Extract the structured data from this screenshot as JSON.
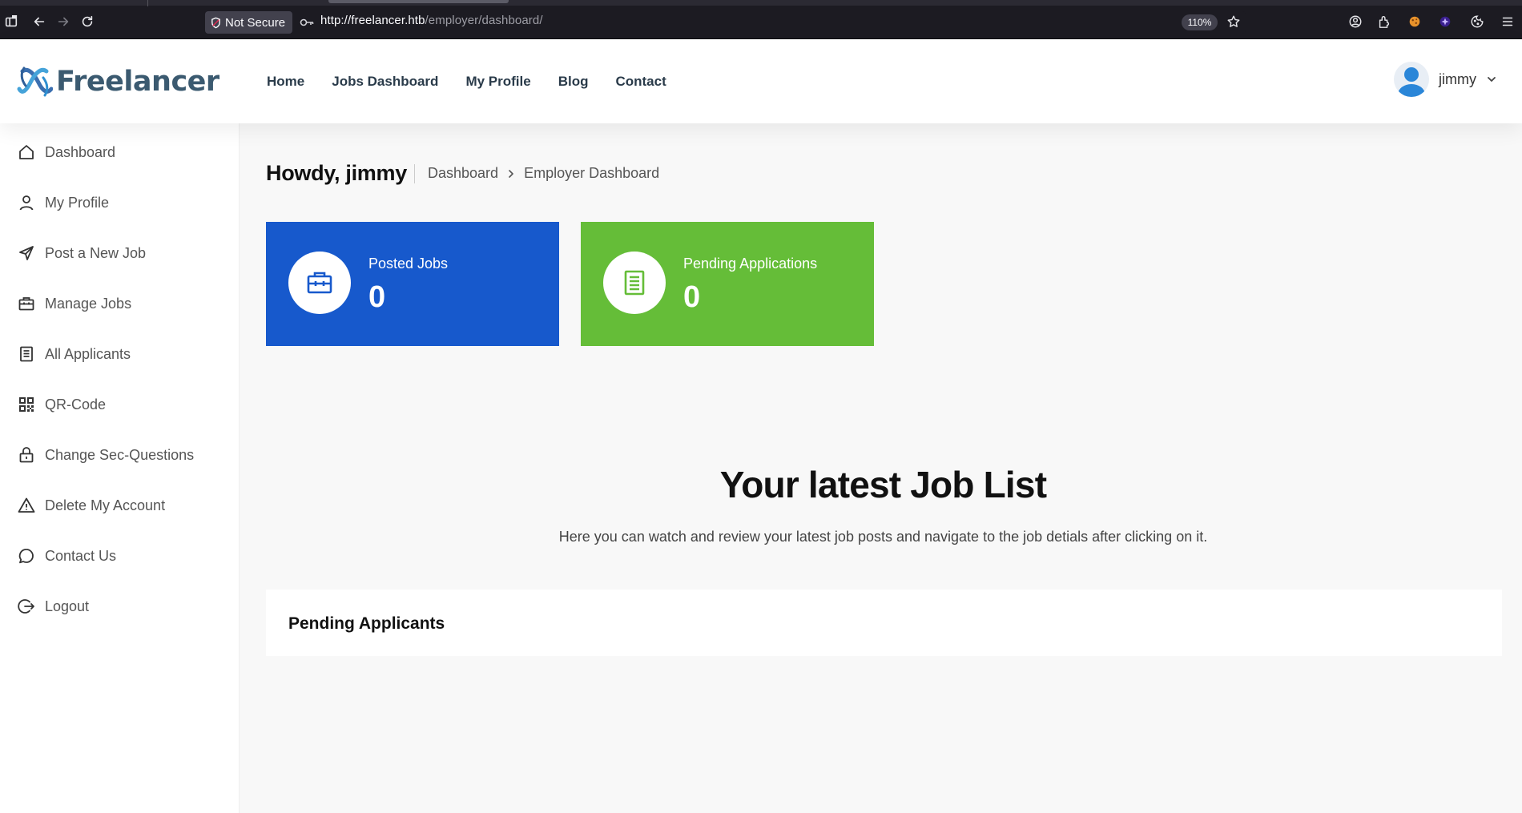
{
  "browser": {
    "security_label": "Not Secure",
    "url_host": "http://freelancer.htb",
    "url_path": "/employer/dashboard/",
    "zoom": "110%"
  },
  "header": {
    "logo_text": "Freelancer",
    "nav": [
      "Home",
      "Jobs Dashboard",
      "My Profile",
      "Blog",
      "Contact"
    ],
    "user_name": "jimmy"
  },
  "sidebar": {
    "items": [
      {
        "label": "Dashboard",
        "icon": "home-icon"
      },
      {
        "label": "My Profile",
        "icon": "user-icon"
      },
      {
        "label": "Post a New Job",
        "icon": "send-icon"
      },
      {
        "label": "Manage Jobs",
        "icon": "briefcase-icon"
      },
      {
        "label": "All Applicants",
        "icon": "document-icon"
      },
      {
        "label": "QR-Code",
        "icon": "qr-code-icon"
      },
      {
        "label": "Change Sec-Questions",
        "icon": "lock-icon"
      },
      {
        "label": "Delete My Account",
        "icon": "warning-icon"
      },
      {
        "label": "Contact Us",
        "icon": "chat-icon"
      },
      {
        "label": "Logout",
        "icon": "logout-icon"
      }
    ]
  },
  "main": {
    "greeting": "Howdy, jimmy",
    "breadcrumb": [
      "Dashboard",
      "Employer Dashboard"
    ],
    "stats": [
      {
        "label": "Posted Jobs",
        "value": "0",
        "color": "#1759cc",
        "icon": "briefcase-icon"
      },
      {
        "label": "Pending Applications",
        "value": "0",
        "color": "#65bd38",
        "icon": "document-icon"
      }
    ],
    "section_title": "Your latest Job List",
    "section_subtitle": "Here you can watch and review your latest job posts and navigate to the job detials after clicking on it.",
    "pending_title": "Pending Applicants"
  }
}
